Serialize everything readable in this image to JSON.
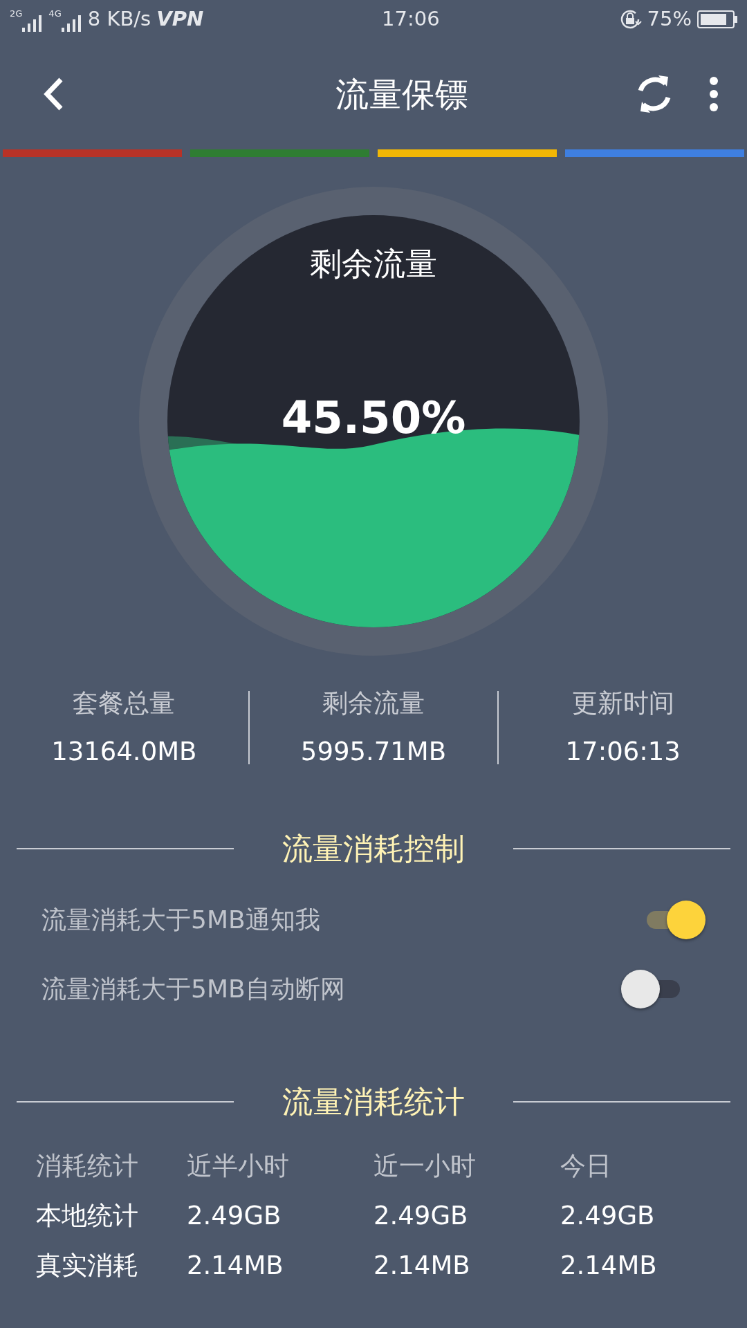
{
  "status_bar": {
    "network_labels": [
      "2G",
      "4G"
    ],
    "speed": "8 KB/s",
    "vpn": "VPN",
    "time": "17:06",
    "battery": "75%"
  },
  "header": {
    "title": "流量保镖"
  },
  "color_bars": [
    {
      "color": "#b83227"
    },
    {
      "color": "#2f7d32"
    },
    {
      "color": "#f2b705"
    },
    {
      "color": "#3f7fe0"
    }
  ],
  "gauge": {
    "label": "剩余流量",
    "percent": "45.50%"
  },
  "stats": [
    {
      "label": "套餐总量",
      "value": "13164.0MB"
    },
    {
      "label": "剩余流量",
      "value": "5995.71MB"
    },
    {
      "label": "更新时间",
      "value": "17:06:13"
    }
  ],
  "control": {
    "title": "流量消耗控制",
    "toggles": [
      {
        "label": "流量消耗大于5MB通知我",
        "on": true
      },
      {
        "label": "流量消耗大于5MB自动断网",
        "on": false
      }
    ]
  },
  "usage": {
    "title": "流量消耗统计",
    "columns": [
      "消耗统计",
      "近半小时",
      "近一小时",
      "今日"
    ],
    "rows": [
      {
        "cells": [
          "本地统计",
          "2.49GB",
          "2.49GB",
          "2.49GB"
        ]
      },
      {
        "cells": [
          "真实消耗",
          "2.14MB",
          "2.14MB",
          "2.14MB"
        ]
      }
    ]
  }
}
